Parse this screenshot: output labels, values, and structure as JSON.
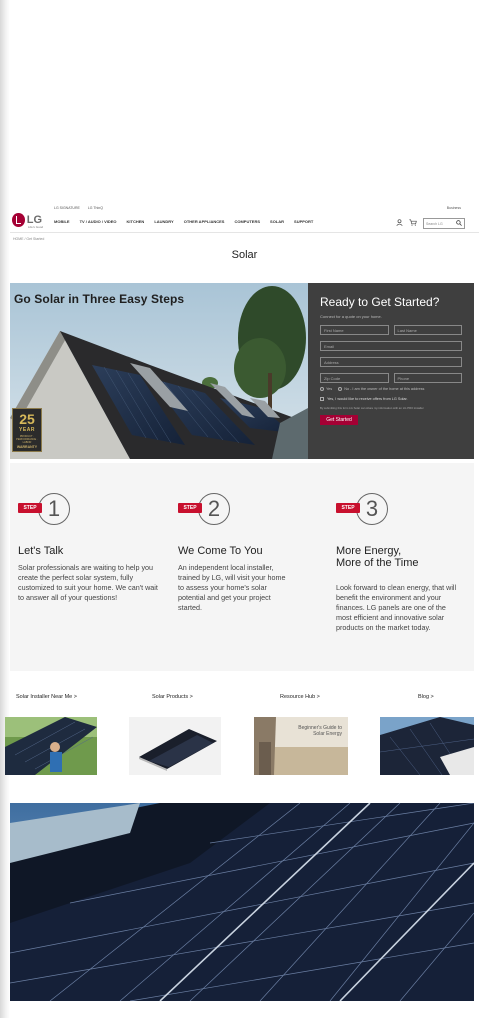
{
  "header": {
    "logo_text": "LG",
    "logo_sub": "Life's Good",
    "top_links": [
      "LG SIGNATURE",
      "LG ThinQ"
    ],
    "business_label": "Business",
    "nav": [
      "MOBILE",
      "TV / AUDIO / VIDEO",
      "KITCHEN",
      "LAUNDRY",
      "OTHER APPLIANCES",
      "COMPUTERS",
      "SOLAR",
      "SUPPORT"
    ],
    "search_placeholder": "Search LG"
  },
  "breadcrumb": "HOME / Get Started",
  "page_title": "Solar",
  "hero": {
    "title": "Go Solar in Three Easy Steps",
    "badge_number": "25",
    "badge_year": "YEAR",
    "badge_small_1": "PRODUCT · PERFORMANCE · LABOR",
    "badge_small_2": "WARRANTY"
  },
  "form": {
    "title": "Ready to Get Started?",
    "subtitle": "Connect for a quote on your home.",
    "first_name": "First Name",
    "last_name": "Last Name",
    "email": "Email",
    "address": "Address",
    "zip": "Zip Code",
    "phone": "Phone",
    "radio_yes": "Yes",
    "radio_no": "No - I am the owner of the home at this address",
    "checkbox": "Yes, I would like to receive offers from LG Solar.",
    "fine_print": "By submitting this form LG Solar can share my information with an LG PRO installer",
    "submit": "Get Started"
  },
  "steps": [
    {
      "tag": "STEP",
      "number": "1",
      "title": "Let's Talk",
      "text": "Solar professionals are waiting to help you create the perfect solar system, fully customized to suit your home. We can't wait to answer all of your questions!"
    },
    {
      "tag": "STEP",
      "number": "2",
      "title": "We Come To You",
      "text": "An independent local installer, trained by LG, will visit your home to assess your home's solar potential and get your project started."
    },
    {
      "tag": "STEP",
      "number": "3",
      "title_1": "More Energy,",
      "title_2": "More of the Time",
      "text": "Look forward to clean energy, that will benefit the environment and your finances. LG panels are one of the most efficient and innovative solar products on the market today."
    }
  ],
  "links": [
    "Solar Installer Near Me >",
    "Solar Products >",
    "Resource Hub >",
    "Blog >"
  ],
  "resource_caption": "Beginner's Guide to Solar Energy",
  "colors": {
    "brand": "#a50034",
    "step_red": "#c8102e",
    "form_bg": "#3f3f3f"
  }
}
